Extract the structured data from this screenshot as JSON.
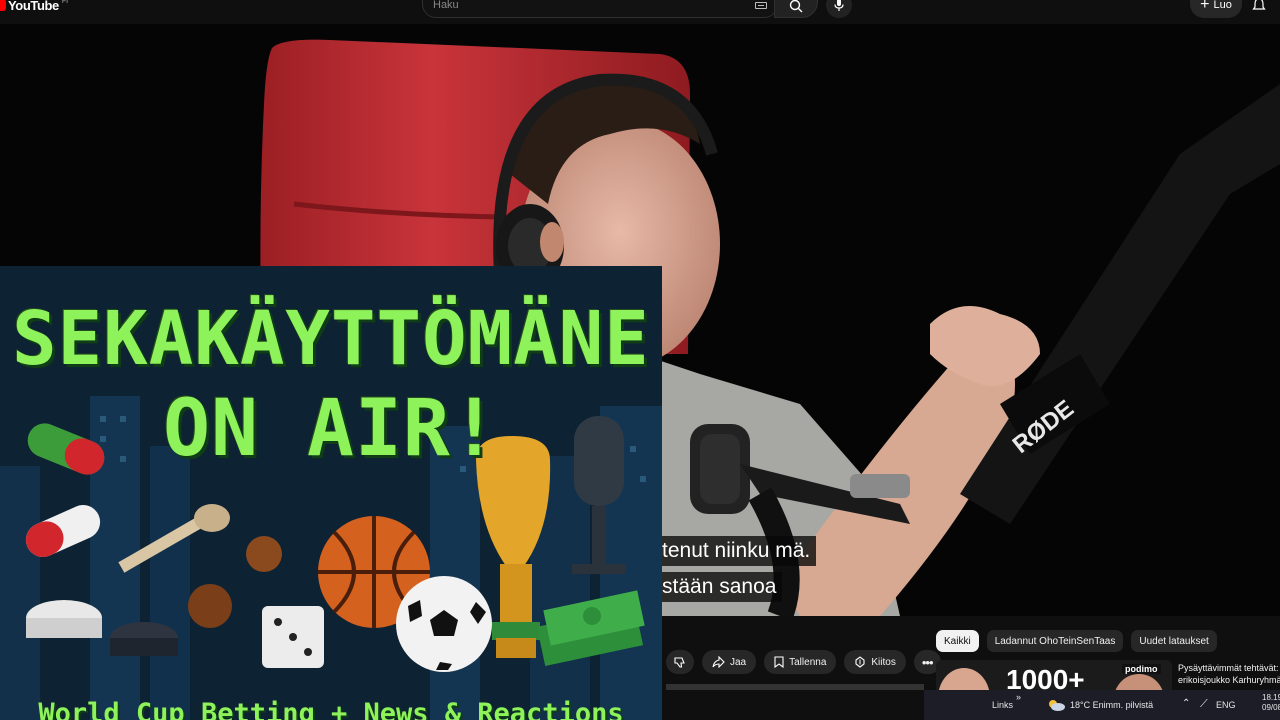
{
  "topbar": {
    "logo_text": "YouTube",
    "logo_sup": "FI",
    "search_placeholder": "Haku",
    "create_label": "Luo"
  },
  "video": {
    "subtitles": [
      "tenut niinku mä.",
      "stään sanoa"
    ],
    "mic_brand": "RØDE"
  },
  "artwork": {
    "title_line1": "SEKAKÄYTTÖMÄNE",
    "title_line2": "ON AIR!",
    "bottom_text": "World Cup Betting + News & Reactions"
  },
  "actions": {
    "share_label": "Jaa",
    "save_label": "Tallenna",
    "thanks_label": "Kiitos"
  },
  "chips": [
    {
      "label": "Kaikki",
      "active": true
    },
    {
      "label": "Ladannut OhoTeinSenTaas",
      "active": false
    },
    {
      "label": "Uudet lataukset",
      "active": false
    }
  ],
  "recommendation": {
    "thumb_text": "1000+",
    "thumb_logo": "podimo",
    "title_line1": "Pysäyttävimmät tehtävät:",
    "title_line2": "erikoisjoukko Karhuryhmä"
  },
  "taskbar": {
    "links_label": "Links",
    "temperature": "18°C",
    "weather_text": "Enimm. pilvistä",
    "language": "ENG",
    "time": "18.19",
    "date": "09/08/2"
  },
  "colors": {
    "brand_red": "#ff0000",
    "art_green": "#8ef25a",
    "art_bg": "#0d2232",
    "chair_red": "#b8262a"
  }
}
